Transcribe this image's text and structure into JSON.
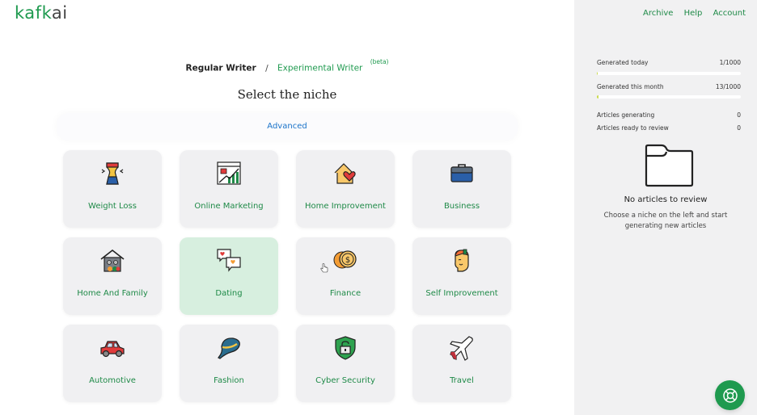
{
  "app": {
    "logo_part1": "kaf",
    "logo_part2": "k",
    "logo_part3": "ai"
  },
  "nav": {
    "archive": "Archive",
    "help": "Help",
    "account": "Account"
  },
  "writer_switch": {
    "regular": "Regular Writer",
    "separator": "/",
    "experimental": "Experimental Writer",
    "beta": "(beta)"
  },
  "main": {
    "title": "Select the niche",
    "advanced": "Advanced"
  },
  "niches": [
    {
      "label": "Weight Loss",
      "icon": "waist-icon",
      "selected": false
    },
    {
      "label": "Online Marketing",
      "icon": "marketing-chart-icon",
      "selected": false
    },
    {
      "label": "Home Improvement",
      "icon": "house-heart-icon",
      "selected": false
    },
    {
      "label": "Business",
      "icon": "briefcase-icon",
      "selected": false
    },
    {
      "label": "Home And Family",
      "icon": "family-house-icon",
      "selected": false
    },
    {
      "label": "Dating",
      "icon": "chat-hearts-icon",
      "selected": true
    },
    {
      "label": "Finance",
      "icon": "coins-icon",
      "selected": false
    },
    {
      "label": "Self Improvement",
      "icon": "head-icon",
      "selected": false
    },
    {
      "label": "Automotive",
      "icon": "car-icon",
      "selected": false
    },
    {
      "label": "Fashion",
      "icon": "hat-icon",
      "selected": false
    },
    {
      "label": "Cyber Security",
      "icon": "shield-lock-icon",
      "selected": false
    },
    {
      "label": "Travel",
      "icon": "airplane-icon",
      "selected": false
    }
  ],
  "sidebar": {
    "stats": [
      {
        "label": "Generated today",
        "value": "1/1000",
        "progress": 0.001
      },
      {
        "label": "Generated this month",
        "value": "13/1000",
        "progress": 0.013
      },
      {
        "label": "Articles generating",
        "value": "0"
      },
      {
        "label": "Articles ready to review",
        "value": "0"
      }
    ],
    "empty_title": "No articles to review",
    "empty_subtitle": "Choose a niche on the left and start generating new articles"
  },
  "colors": {
    "brand_green": "#1f9a4f",
    "link_blue": "#1a73c9",
    "selected_card": "#d7efdf"
  }
}
